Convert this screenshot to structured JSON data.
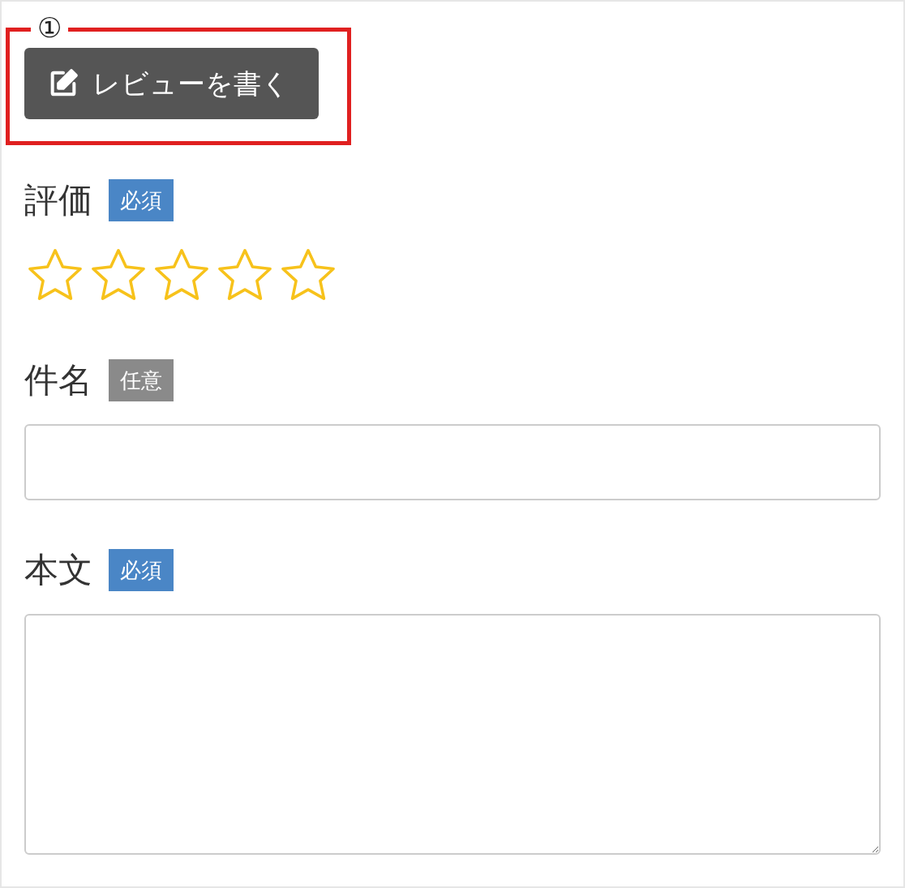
{
  "annotation": {
    "number": "①"
  },
  "write_review_button": {
    "label": "レビューを書く"
  },
  "fields": [
    {
      "kind": "stars",
      "label": "評価",
      "badge": {
        "text": "必須",
        "required": true
      },
      "stars": 0
    },
    {
      "kind": "input",
      "label": "件名",
      "badge": {
        "text": "任意",
        "required": false
      }
    },
    {
      "kind": "textarea",
      "label": "本文",
      "badge": {
        "text": "必須",
        "required": true
      }
    }
  ]
}
